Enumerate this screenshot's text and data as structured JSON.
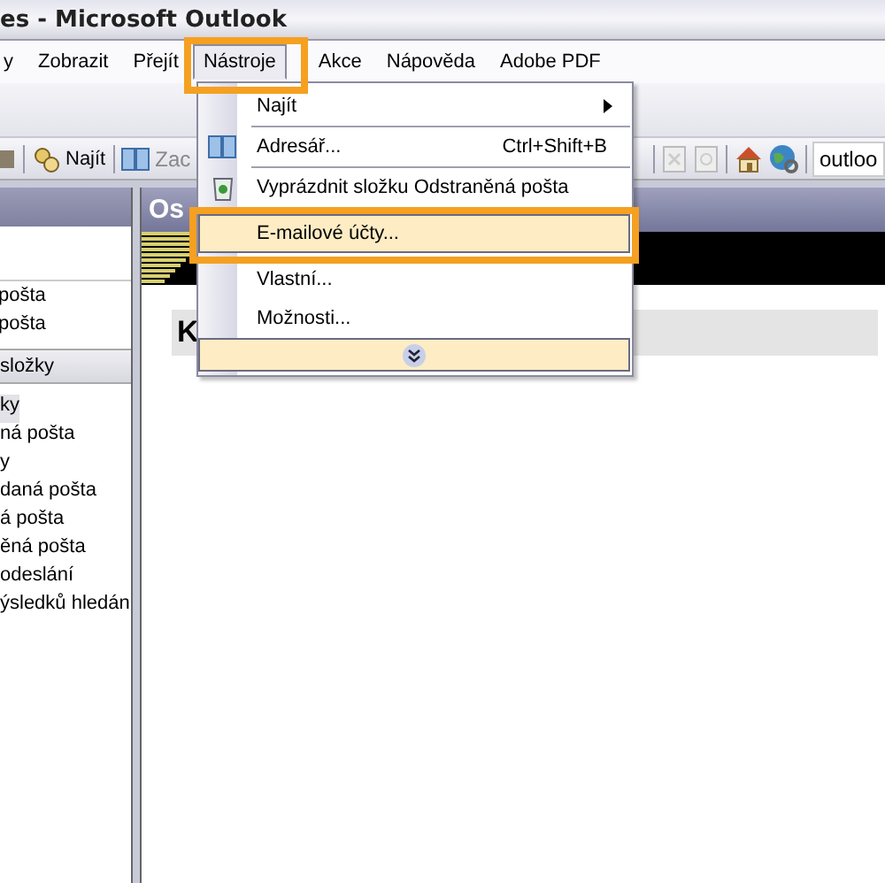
{
  "window": {
    "title": "es - Microsoft Outlook"
  },
  "menu_bar": [
    {
      "label": "y",
      "selected": false
    },
    {
      "label": "Zobrazit",
      "selected": false
    },
    {
      "label": "Přejít",
      "selected": false
    },
    {
      "label": "Nástroje",
      "selected": true
    },
    {
      "label": "Akce",
      "selected": false
    },
    {
      "label": "Nápověda",
      "selected": false
    },
    {
      "label": "Adobe PDF",
      "selected": false
    }
  ],
  "toolbar": {
    "find_button": "Najít",
    "address_text": "Zac",
    "address_field": {
      "value": "outloo"
    }
  },
  "navigation_pane": {
    "favorites": [
      "pošta",
      "pošta"
    ],
    "section_title": "složky",
    "folders": [
      {
        "label": "ky",
        "selected": true
      },
      {
        "label": "ná pošta",
        "selected": false
      },
      {
        "label": "y",
        "selected": false
      },
      {
        "label": "daná pošta",
        "selected": false
      },
      {
        "label": "á pošta",
        "selected": false
      },
      {
        "label": "ěná pošta",
        "selected": false
      },
      {
        "label": "odeslání",
        "selected": false
      },
      {
        "label": "ýsledků hledán",
        "selected": false
      }
    ]
  },
  "content": {
    "header": "Os",
    "heading": "K"
  },
  "dropdown_menu": {
    "items": [
      {
        "kind": "submenu",
        "label": "Najít",
        "selected": false
      },
      {
        "kind": "separator"
      },
      {
        "kind": "addressbook",
        "label": "Adresář...",
        "shortcut": "Ctrl+Shift+B",
        "selected": false
      },
      {
        "kind": "separator"
      },
      {
        "kind": "empty",
        "label": "Vyprázdnit složku  Odstraněná pošta",
        "selected": false
      },
      {
        "kind": "command",
        "label": "E-mailové účty...",
        "selected": true
      },
      {
        "kind": "command",
        "label": "Vlastní...",
        "selected": false
      },
      {
        "kind": "command",
        "label": "Možnosti...",
        "selected": false
      },
      {
        "kind": "expand",
        "selected": true
      }
    ]
  }
}
